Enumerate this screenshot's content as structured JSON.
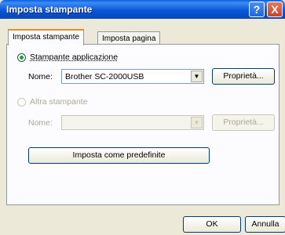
{
  "window": {
    "title": "Imposta stampante"
  },
  "titlebar": {
    "help_glyph": "?",
    "close_glyph": "X"
  },
  "tabs": [
    {
      "label": "Imposta stampante",
      "active": true
    },
    {
      "label": "Imposta pagina",
      "active": false
    }
  ],
  "app_printer": {
    "radio_label": "Stampante applicazione",
    "selected": true,
    "name_label": "Nome:",
    "name_value": "Brother SC-2000USB",
    "properties_label": "Proprietà..."
  },
  "other_printer": {
    "radio_label": "Altra stampante",
    "selected": false,
    "enabled": false,
    "name_label": "Nome:",
    "name_value": "",
    "properties_label": "Proprietà..."
  },
  "set_default_label": "Imposta come predefinite",
  "footer": {
    "ok_label": "OK",
    "cancel_label": "Annulla"
  },
  "icons": {
    "dropdown": "chevron-down-icon"
  },
  "colors": {
    "title_blue": "#0a56d8",
    "tab_accent": "#e68b2c",
    "radio_green": "#21a121"
  }
}
